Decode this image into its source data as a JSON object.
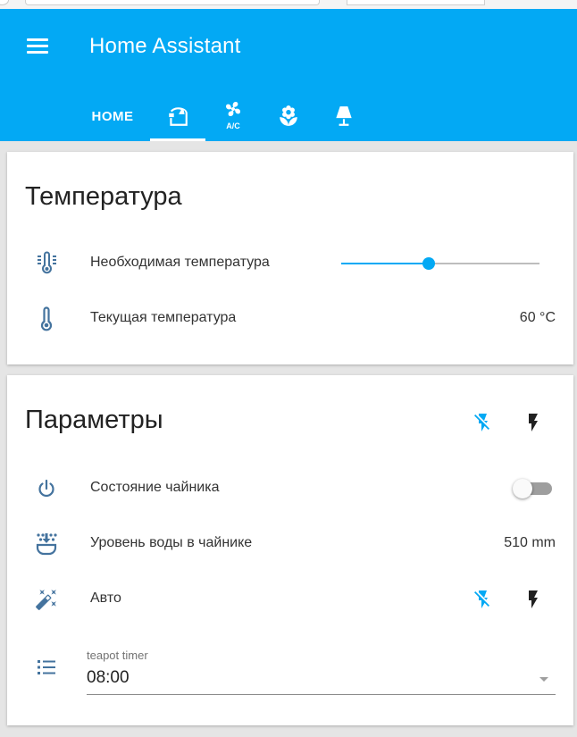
{
  "colors": {
    "accent": "#03a9f4",
    "header_bg": "#03a9f4",
    "icon": "#44739e",
    "on_color": "#03a9f4",
    "off_color": "#212121"
  },
  "header": {
    "title": "Home Assistant",
    "menu_icon": "menu-icon",
    "tabs": [
      {
        "label": "HOME",
        "type": "text"
      },
      {
        "icon": "kettle-icon",
        "active": true
      },
      {
        "icon": "air-conditioner-icon"
      },
      {
        "icon": "flower-icon"
      },
      {
        "icon": "lamp-icon"
      }
    ]
  },
  "card_temperature": {
    "title": "Температура",
    "rows": [
      {
        "icon": "thermometer-lines-icon",
        "label": "Необходимая температура",
        "control": "slider",
        "slider_value": 0.44
      },
      {
        "icon": "thermometer-icon",
        "label": "Текущая температура",
        "value": "60 °C"
      }
    ]
  },
  "card_params": {
    "title": "Параметры",
    "header_buttons": [
      {
        "icon": "flash-off-icon"
      },
      {
        "icon": "flash-icon"
      }
    ],
    "rows": [
      {
        "icon": "power-icon",
        "label": "Состояние чайника",
        "control": "toggle",
        "state": "off"
      },
      {
        "icon": "water-level-icon",
        "label": "Уровень воды в чайнике",
        "value": "510 mm"
      },
      {
        "icon": "auto-fix-icon",
        "label": "Авто",
        "buttons": [
          {
            "icon": "flash-off-icon"
          },
          {
            "icon": "flash-icon"
          }
        ]
      }
    ],
    "input_select": {
      "icon": "format-list-bulleted-icon",
      "label": "teapot timer",
      "value": "08:00"
    }
  }
}
